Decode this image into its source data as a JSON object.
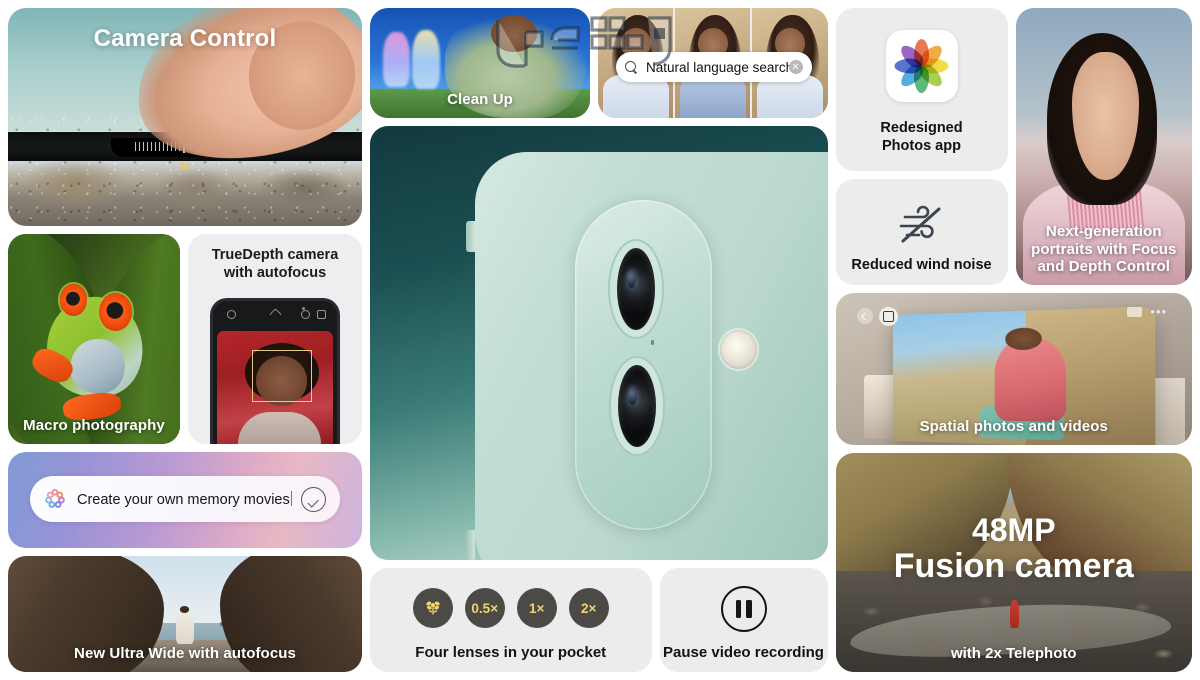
{
  "page": {
    "background_color": "#ffffff",
    "frame_color": "#000000"
  },
  "watermark": {
    "name": "arabic-logo-watermark",
    "opacity": "0.55"
  },
  "left_column": {
    "camera_control": {
      "title": "Camera Control",
      "zoom_label": "1x"
    },
    "macro": {
      "caption": "Macro photography"
    },
    "truedepth": {
      "title_line1": "TrueDepth camera",
      "title_line2": "with autofocus"
    },
    "memory": {
      "text": "Create your own memory movies",
      "ai_icon": "apple-intelligence-icon",
      "confirm_icon": "check-circle-icon"
    },
    "ultrawide": {
      "caption": "New Ultra Wide with autofocus"
    }
  },
  "middle_column": {
    "cleanup": {
      "caption": "Clean Up"
    },
    "search": {
      "value": "Natural language search",
      "search_icon": "search-icon",
      "clear_icon": "clear-circle-icon"
    },
    "hero": {
      "alt": "iPhone rear camera module"
    },
    "lenses": {
      "caption": "Four lenses in your pocket",
      "buttons": [
        {
          "label": "",
          "icon": "macro-flower-icon"
        },
        {
          "label": "0.5×",
          "icon": ""
        },
        {
          "label": "1×",
          "icon": ""
        },
        {
          "label": "2×",
          "icon": ""
        }
      ],
      "button_bg": "#4c4a46",
      "button_fg": "#f2d46a"
    },
    "pause": {
      "caption": "Pause video recording",
      "icon": "pause-circle-icon"
    }
  },
  "right_column": {
    "photos_app": {
      "caption_line1": "Redesigned",
      "caption_line2": "Photos app",
      "icon": "photos-app-icon",
      "petal_colors": [
        "#e8643c",
        "#f0a02c",
        "#f2d62e",
        "#9dc83a",
        "#46b06a",
        "#3ba3d6",
        "#3f62c4",
        "#8b4fc0"
      ]
    },
    "wind": {
      "caption": "Reduced wind noise",
      "icon": "wind-noise-off-icon"
    },
    "portrait": {
      "caption_line1": "Next-generation",
      "caption_line2": "portraits with Focus",
      "caption_line3": "and Depth Control"
    },
    "spatial": {
      "caption": "Spatial photos and videos"
    },
    "fusion": {
      "title_line1": "48MP",
      "title_line2": "Fusion camera",
      "subtitle": "with 2x Telephoto"
    }
  }
}
